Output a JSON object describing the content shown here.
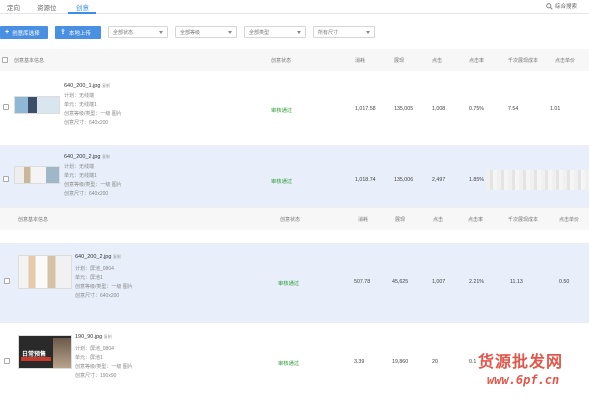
{
  "tabs": [
    "定向",
    "资源位",
    "创意"
  ],
  "search": {
    "label": "综合搜索"
  },
  "toolbar": {
    "add_button": "创意库选择",
    "upload_button": "本地上传",
    "filters": [
      "全部状态",
      "全部等级",
      "全部类型",
      "所有尺寸"
    ]
  },
  "table": {
    "columns": [
      "创意基本信息",
      "创意状态",
      "消耗",
      "展现",
      "点击",
      "点击率",
      "千次展现成本",
      "点击单价"
    ]
  },
  "rows": [
    {
      "name": "640_200_1.jpg",
      "name_suffix": "复制",
      "plan": "计划：无线端",
      "unit": "单元：无线端1",
      "level": "创意等级/类型：一级 图片",
      "size": "创意尺寸：640x200",
      "status": "审核通过",
      "cost": "1,017.58",
      "impressions": "135,005",
      "clicks": "1,008",
      "ctr": "0.75%",
      "cpm": "7.54",
      "cpc": "1.01"
    },
    {
      "name": "640_200_2.jpg",
      "name_suffix": "复制",
      "plan": "计划：无线端",
      "unit": "单元：无线端1",
      "level": "创意等级/类型：一级 图片",
      "size": "创意尺寸：640x200",
      "status": "审核通过",
      "cost": "1,018.74",
      "impressions": "135,006",
      "clicks": "2,497",
      "ctr": "1.85%",
      "cpm": "",
      "cpc": ""
    },
    {
      "name": "640_200_2.jpg",
      "name_suffix": "复制",
      "plan": "计划：屏池_0804",
      "unit": "单元：屏池1",
      "level": "创意等级/类型：一级 图片",
      "size": "创意尺寸：640x200",
      "status": "审核通过",
      "cost": "507.78",
      "impressions": "45,625",
      "clicks": "1,007",
      "ctr": "2.21%",
      "cpm": "11.13",
      "cpc": "0.50"
    },
    {
      "name": "190_90.jpg",
      "name_suffix": "复制",
      "plan": "计划：屏池_0804",
      "unit": "单元：屏池1",
      "level": "创意等级/类型：一级 图片",
      "size": "创意尺寸：190x90",
      "status": "审核通过",
      "cost": "3.39",
      "impressions": "19,860",
      "clicks": "20",
      "ctr": "0.1",
      "cpm": "",
      "cpc": ""
    }
  ],
  "thumb_text": "日常预售",
  "watermark": {
    "line1": "货源批发网",
    "line2": "www.6pf.cn"
  },
  "colors": {
    "accent": "#4a90e2",
    "status_green": "#2e9b3a",
    "highlight_row": "#e8effb",
    "watermark": "#e2574c"
  }
}
